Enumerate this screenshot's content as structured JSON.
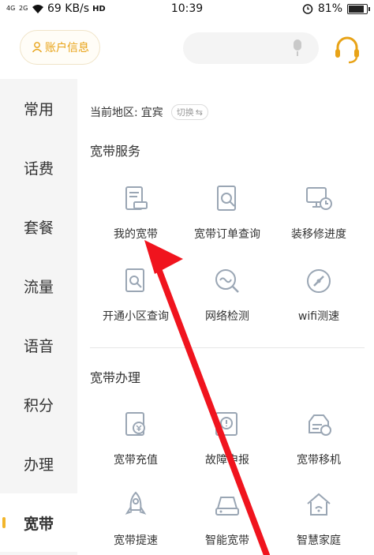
{
  "status_bar": {
    "signal_1": "4G",
    "signal_2": "2G",
    "speed": "69 KB/s",
    "volte": "HD",
    "time": "10:39",
    "battery": "81%",
    "battery_level": 0.81
  },
  "header": {
    "account_label": "账户信息",
    "search_placeholder": "",
    "accent_color": "#e8a317"
  },
  "sidebar": {
    "items": [
      {
        "label": "常用",
        "active": false
      },
      {
        "label": "话费",
        "active": false
      },
      {
        "label": "套餐",
        "active": false
      },
      {
        "label": "流量",
        "active": false
      },
      {
        "label": "语音",
        "active": false
      },
      {
        "label": "积分",
        "active": false
      },
      {
        "label": "办理",
        "active": false
      },
      {
        "label": "宽带",
        "active": true
      }
    ]
  },
  "main": {
    "region_label": "当前地区:",
    "region_value": "宜宾",
    "switch_label": "切换",
    "sections": [
      {
        "title": "宽带服务",
        "items": [
          {
            "label": "我的宽带",
            "icon": "my-broadband-icon"
          },
          {
            "label": "宽带订单查询",
            "icon": "order-query-icon"
          },
          {
            "label": "装移修进度",
            "icon": "install-progress-icon"
          },
          {
            "label": "开通小区查询",
            "icon": "community-query-icon"
          },
          {
            "label": "网络检测",
            "icon": "network-check-icon"
          },
          {
            "label": "wifi测速",
            "icon": "wifi-speed-icon"
          }
        ]
      },
      {
        "title": "宽带办理",
        "items": [
          {
            "label": "宽带充值",
            "icon": "recharge-icon"
          },
          {
            "label": "故障申报",
            "icon": "fault-report-icon"
          },
          {
            "label": "宽带移机",
            "icon": "relocate-icon"
          },
          {
            "label": "宽带提速",
            "icon": "speed-up-icon"
          },
          {
            "label": "智能宽带",
            "icon": "smart-broadband-icon"
          },
          {
            "label": "智慧家庭",
            "icon": "smart-home-icon"
          }
        ]
      }
    ]
  }
}
